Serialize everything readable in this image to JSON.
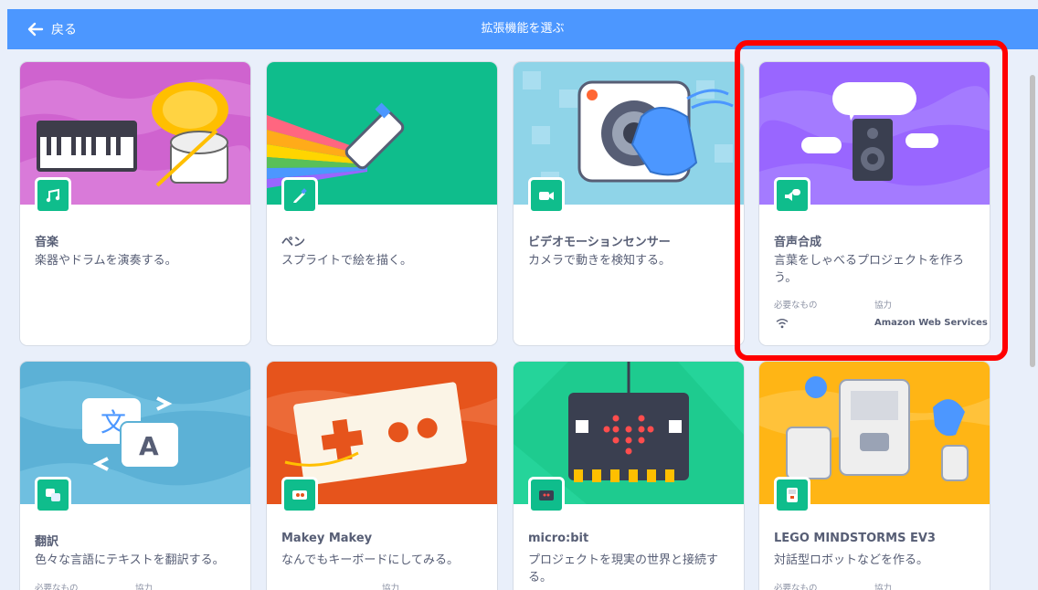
{
  "header": {
    "back_label": "戻る",
    "title": "拡張機能を選ぶ",
    "background": "#4c97ff"
  },
  "cards": [
    {
      "name": "音楽",
      "description": "楽器やドラムを演奏する。",
      "color": "#cf63cf",
      "icon": "music-notes-icon"
    },
    {
      "name": "ペン",
      "description": "スプライトで絵を描く。",
      "color": "#0fbd8c",
      "icon": "pen-icon"
    },
    {
      "name": "ビデオモーションセンサー",
      "description": "カメラで動きを検知する。",
      "color": "#0fbd8c",
      "icon": "video-camera-icon"
    },
    {
      "name": "音声合成",
      "description": "言葉をしゃべるプロジェクトを作ろう。",
      "color": "#9966ff",
      "icon": "speech-icon",
      "requires_label": "必要なもの",
      "partner_label": "協力",
      "partner": "Amazon Web Services",
      "requirement_icon": "wifi-icon"
    },
    {
      "name": "翻訳",
      "description": "色々な言語にテキストを翻訳する。",
      "color": "#5cb1d6",
      "icon": "translate-icon",
      "requires_label": "必要なもの",
      "partner_label": "協力"
    },
    {
      "name": "Makey Makey",
      "description": "なんでもキーボードにしてみる。",
      "color": "#e6541c",
      "icon": "makey-makey-icon",
      "partner_label": "協力"
    },
    {
      "name": "micro:bit",
      "description": "プロジェクトを現実の世界と接続する。",
      "color": "#1ecb8f",
      "icon": "microbit-icon"
    },
    {
      "name": "LEGO MINDSTORMS EV3",
      "description": "対話型ロボットなどを作る。",
      "color": "#ffb515",
      "icon": "ev3-icon",
      "requires_label": "必要なもの",
      "partner_label": "協力"
    }
  ]
}
